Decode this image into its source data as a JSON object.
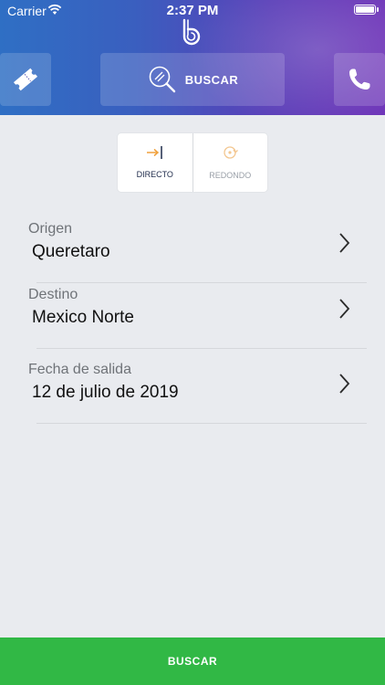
{
  "status_bar": {
    "carrier": "Carrier",
    "time": "2:37 PM"
  },
  "header": {
    "logo_icon": "brand-b-logo",
    "nav": {
      "ticket_icon": "ticket-icon",
      "search_label": "BUSCAR",
      "search_icon": "magnifier-icon",
      "phone_icon": "phone-icon"
    }
  },
  "trip_type": {
    "options": [
      {
        "label": "DIRECTO",
        "icon": "arrow-right-bar-icon",
        "active": true
      },
      {
        "label": "REDONDO",
        "icon": "round-trip-icon",
        "active": false
      }
    ]
  },
  "form": {
    "origin": {
      "label": "Origen",
      "value": "Queretaro"
    },
    "destination": {
      "label": "Destino",
      "value": "Mexico Norte"
    },
    "departure": {
      "label": "Fecha de salida",
      "value": "12 de julio de 2019"
    }
  },
  "footer": {
    "search_button": "BUSCAR"
  },
  "colors": {
    "accent_orange": "#f0a13c",
    "button_green": "#31b845",
    "header_start": "#2f6fc4",
    "header_end": "#6e34b8"
  }
}
